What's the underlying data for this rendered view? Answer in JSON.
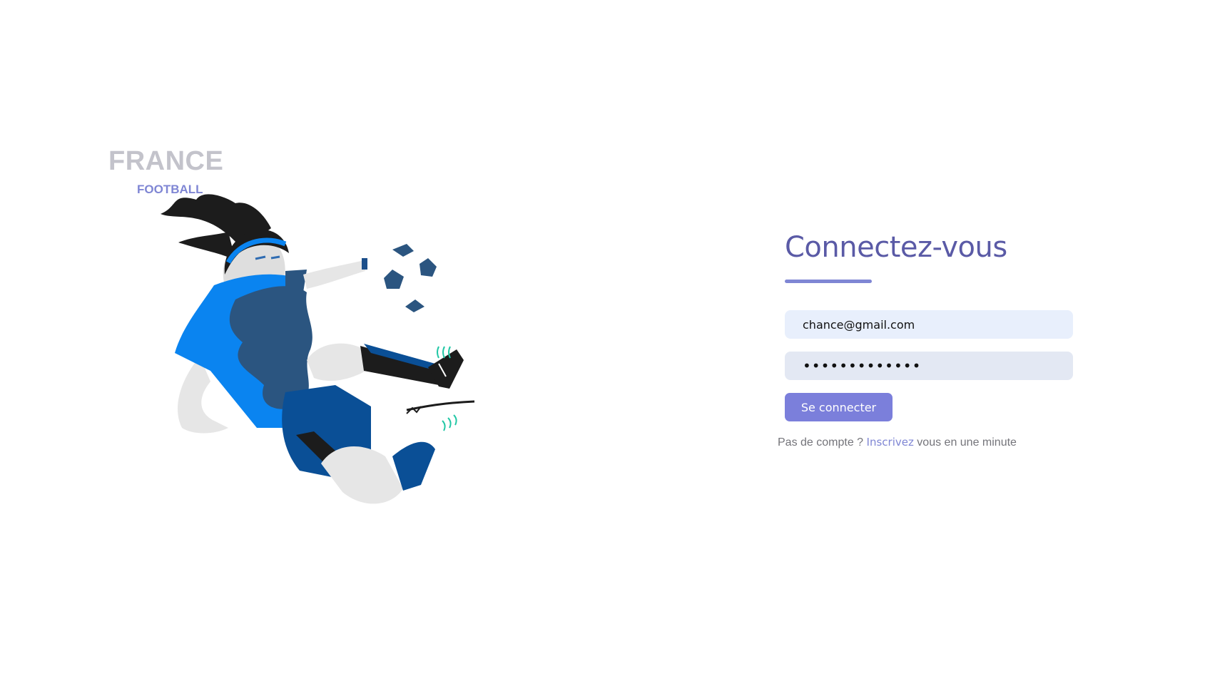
{
  "brand": {
    "title": "FRANCE",
    "subtitle": "FOOTBALL"
  },
  "illustration": {
    "icon": "female-soccer-player-kicking-ball-illustration"
  },
  "login": {
    "title": "Connectez-vous",
    "email": {
      "value": "chance@gmail.com",
      "placeholder": ""
    },
    "password": {
      "value": "•••••••••••••",
      "placeholder": ""
    },
    "submit_label": "Se connecter",
    "signup_prefix": "Pas de compte ?",
    "signup_link": "Inscrivez",
    "signup_suffix": "vous en une minute"
  },
  "colors": {
    "accent": "#7b7fdb",
    "title": "#5a5aa6",
    "brand_gray": "#c3c3cb",
    "input_bg": "#e8effc",
    "jersey_light_blue": "#0a84f0",
    "jersey_dark_blue": "#2b5580"
  }
}
